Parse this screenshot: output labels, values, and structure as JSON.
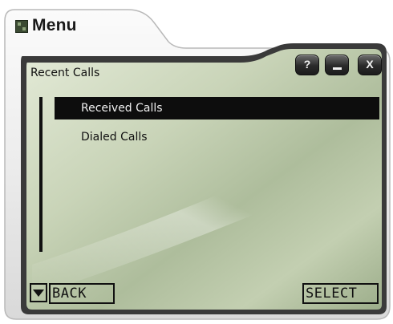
{
  "window": {
    "title": "Menu",
    "title_icon": "menu-icon",
    "controls": {
      "help_label": "?",
      "minimize_icon": "minimize-icon",
      "close_label": "X"
    }
  },
  "screen": {
    "title": "Recent Calls",
    "items": [
      {
        "label": "Received Calls",
        "selected": true
      },
      {
        "label": "Dialed Calls",
        "selected": false
      }
    ]
  },
  "softkeys": {
    "down_icon": "down-arrow-icon",
    "back_label": "BACK",
    "select_label": "SELECT"
  },
  "colors": {
    "lcd_light": "#d9e2cc",
    "lcd_dark": "#8fa27e",
    "frame": "#efefef",
    "ink": "#111111"
  }
}
